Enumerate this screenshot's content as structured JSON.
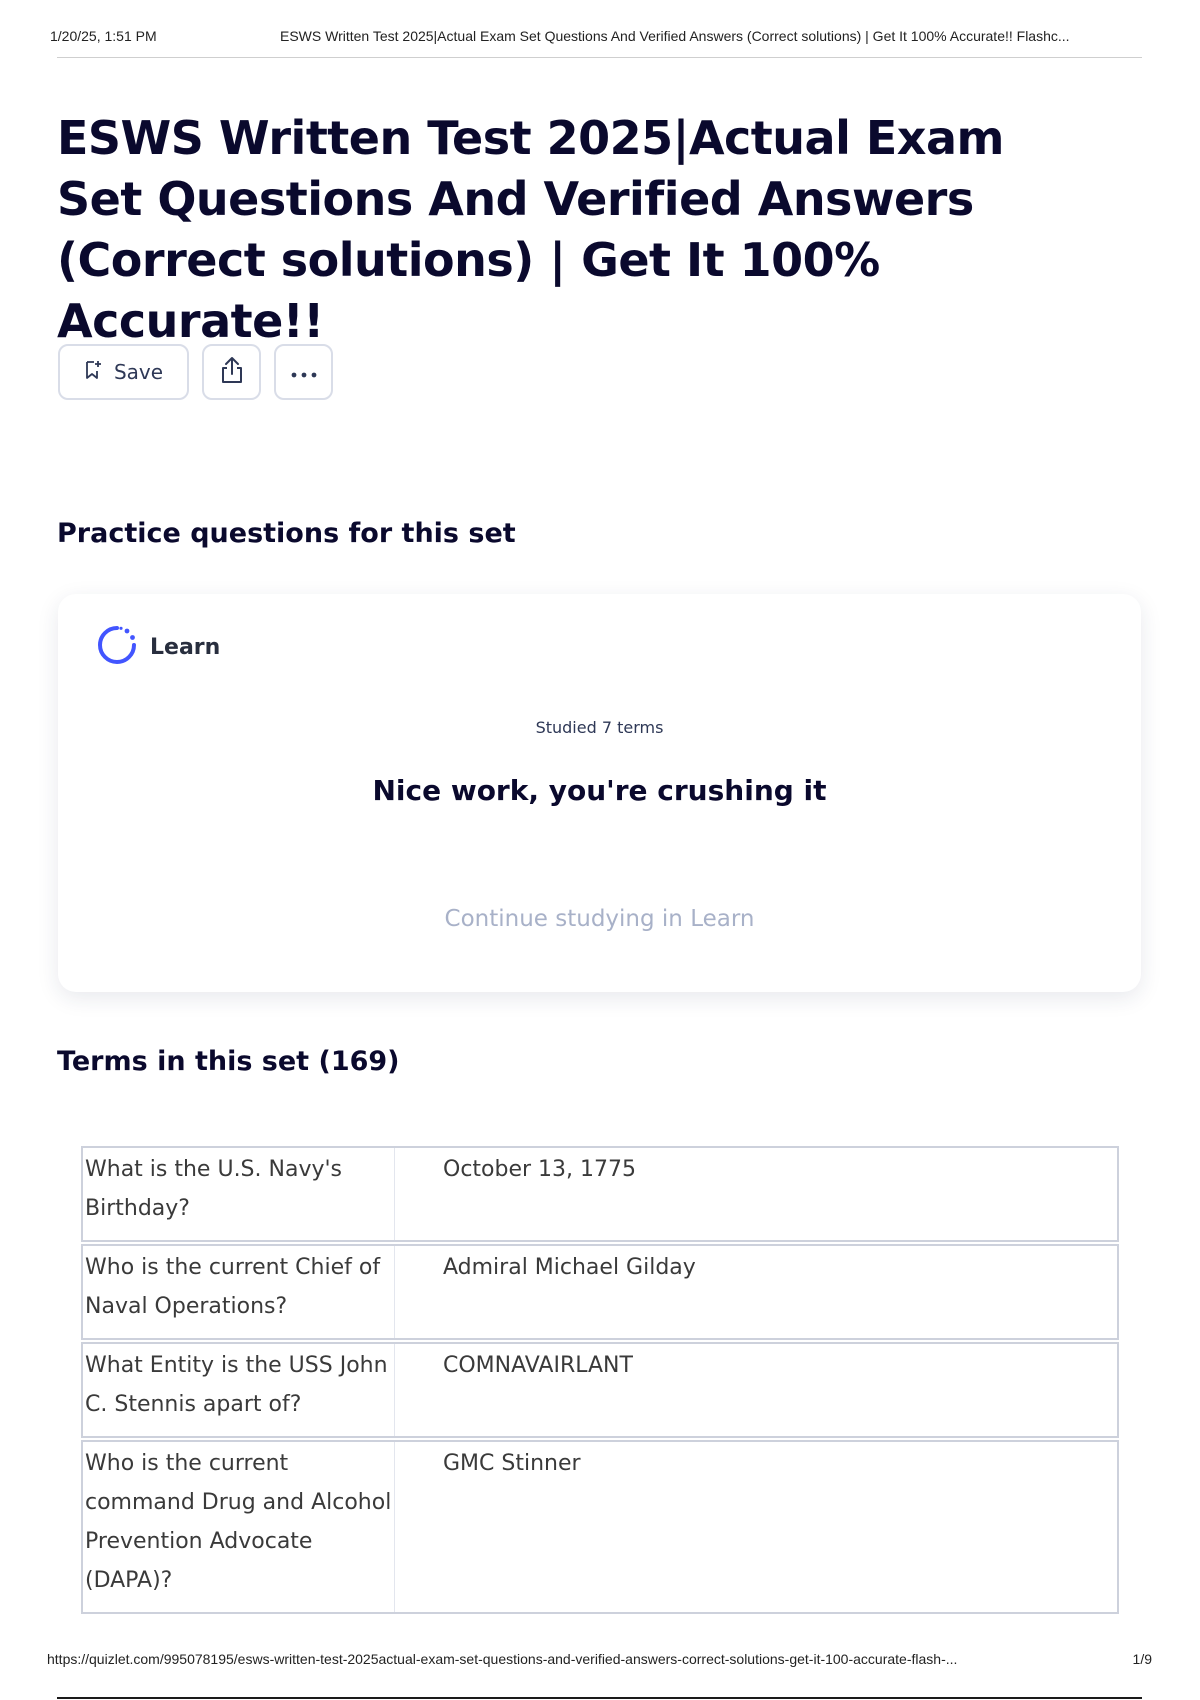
{
  "print_header": {
    "timestamp": "1/20/25, 1:51 PM",
    "title": "ESWS Written Test 2025|Actual Exam Set Questions And Verified Answers (Correct solutions) | Get It 100% Accurate!! Flashc..."
  },
  "page": {
    "title": "ESWS Written Test 2025|Actual Exam Set Questions And Verified Answers (Correct solutions) | Get It 100% Accurate!!"
  },
  "actions": {
    "save_label": "Save",
    "icons": [
      "bookmark-add-icon",
      "share-icon",
      "more-options-icon"
    ]
  },
  "practice": {
    "heading": "Practice questions for this set",
    "learn_label": "Learn",
    "studied_text": "Studied 7 terms",
    "message": "Nice work, you're crushing it",
    "continue_label": "Continue studying in Learn",
    "accent_color": "#4255ff"
  },
  "terms": {
    "heading": "Terms in this set (169)",
    "items": [
      {
        "question": "What is the U.S. Navy's Birthday?",
        "answer": "October 13, 1775"
      },
      {
        "question": "Who is the current Chief of Naval Operations?",
        "answer": "Admiral Michael Gilday"
      },
      {
        "question": "What Entity is the USS John C. Stennis apart of?",
        "answer": "COMNAVAIRLANT"
      },
      {
        "question": "Who is the current command Drug and Alcohol Prevention Advocate (DAPA)?",
        "answer": "GMC Stinner"
      }
    ]
  },
  "print_footer": {
    "url": "https://quizlet.com/995078195/esws-written-test-2025actual-exam-set-questions-and-verified-answers-correct-solutions-get-it-100-accurate-flash-...",
    "page": "1/9"
  }
}
